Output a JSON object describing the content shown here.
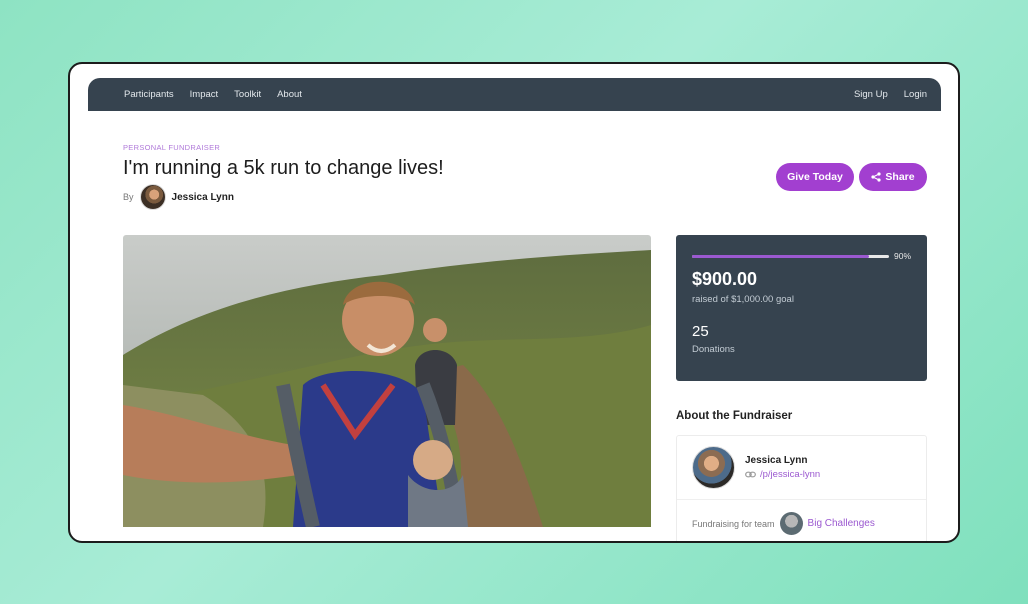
{
  "nav": {
    "left": [
      "Participants",
      "Impact",
      "Toolkit",
      "About"
    ],
    "right": [
      "Sign Up",
      "Login"
    ]
  },
  "header": {
    "eyebrow": "PERSONAL FUNDRAISER",
    "title": "I'm running a 5k run to change lives!",
    "by_label": "By",
    "author": "Jessica Lynn"
  },
  "actions": {
    "give_label": "Give Today",
    "share_label": "Share"
  },
  "stats": {
    "progress_fraction": 0.9,
    "progress_label": "90%",
    "raised": "$900.00",
    "goal_text": "raised of $1,000.00 goal",
    "donations_count": "25",
    "donations_label": "Donations"
  },
  "about": {
    "heading": "About the Fundraiser",
    "name": "Jessica Lynn",
    "profile_link": "/p/jessica-lynn",
    "team_label": "Fundraising for team",
    "team_name": "Big Challenges"
  },
  "colors": {
    "accent": "#a23fd0",
    "nav_bg": "#36434f",
    "link": "#9b59d0"
  },
  "icons": {
    "share": "share-icon",
    "link": "link-icon"
  }
}
